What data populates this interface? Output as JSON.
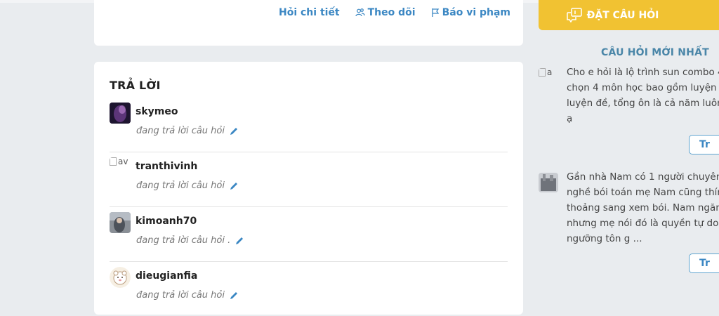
{
  "question": {
    "actions": [
      {
        "label": "Hỏi chi tiết",
        "icon": "none"
      },
      {
        "label": "Theo dõi",
        "icon": "users-icon"
      },
      {
        "label": "Báo vi phạm",
        "icon": "flag-icon"
      }
    ]
  },
  "answers": {
    "title": "TRẢ LỜI",
    "items": [
      {
        "username": "skymeo",
        "status": "đang trả lời câu hỏi",
        "avatar_alt": ""
      },
      {
        "username": "tranthivinh",
        "status": "đang trả lời câu hỏi",
        "avatar_alt": "av"
      },
      {
        "username": "kimoanh70",
        "status": "đang trả lời câu hỏi .",
        "avatar_alt": ""
      },
      {
        "username": "dieugianfia",
        "status": "đang trả lời câu hỏi",
        "avatar_alt": ""
      }
    ]
  },
  "sidebar": {
    "ask_button": "ĐẶT CÂU HỎI",
    "recent_title": "CÂU HỎI MỚI NHẤT",
    "recent": [
      {
        "avatar_alt": "a",
        "lines": [
          "Cho e hỏi là lộ trình sun combo 4",
          "chọn 4 môn học bao gồm luyện t",
          "luyện đề, tổng ôn là cả năm luôn",
          "ạ"
        ],
        "button": "Tr"
      },
      {
        "avatar_alt": "",
        "lines": [
          "Gần nhà Nam có 1 người chuyên",
          "nghề bói toán mẹ Nam cũng thín",
          "thoảng sang xem bói. Nam ngăn",
          "nhưng mẹ nói đó là quyền tự do t",
          "ngưỡng tôn g ..."
        ],
        "button": "Tr"
      }
    ]
  },
  "colors": {
    "link": "#3b87c3",
    "ask_button_bg": "#f1c232",
    "section_title": "#4a86a8",
    "page_bg": "#e9ecef"
  }
}
